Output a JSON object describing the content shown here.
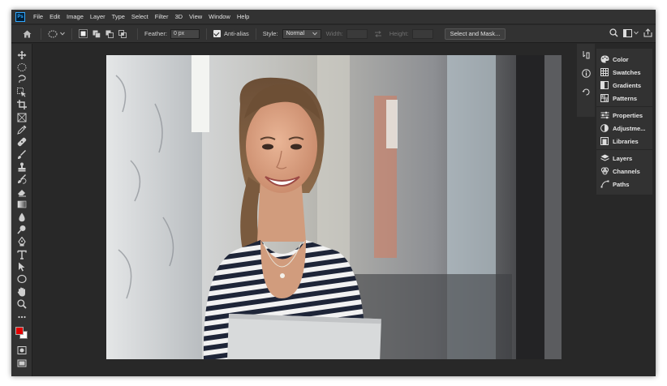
{
  "app": {
    "logo_text": "Ps"
  },
  "menu": [
    "File",
    "Edit",
    "Image",
    "Layer",
    "Type",
    "Select",
    "Filter",
    "3D",
    "View",
    "Window",
    "Help"
  ],
  "options": {
    "feather_label": "Feather:",
    "feather_value": "0 px",
    "antialias_label": "Anti-alias",
    "antialias_checked": true,
    "style_label": "Style:",
    "style_value": "Normal",
    "width_label": "Width:",
    "height_label": "Height:",
    "mask_button": "Select and Mask..."
  },
  "colors": {
    "foreground": "#e20000",
    "background": "#ffffff",
    "ui_dark": "#282828",
    "ui_panel": "#323232"
  },
  "tools": [
    "move-tool-icon",
    "marquee-tool-icon",
    "lasso-tool-icon",
    "object-select-tool-icon",
    "crop-tool-icon",
    "frame-tool-icon",
    "eyedropper-tool-icon",
    "healing-brush-tool-icon",
    "brush-tool-icon",
    "clone-stamp-tool-icon",
    "history-brush-tool-icon",
    "eraser-tool-icon",
    "gradient-tool-icon",
    "blur-tool-icon",
    "dodge-tool-icon",
    "pen-tool-icon",
    "type-tool-icon",
    "path-select-tool-icon",
    "shape-tool-icon",
    "hand-tool-icon",
    "zoom-tool-icon",
    "more-tools-icon"
  ],
  "panels": {
    "group1": [
      "Color",
      "Swatches",
      "Gradients",
      "Patterns"
    ],
    "group2": [
      "Properties",
      "Adjustme...",
      "Libraries"
    ],
    "group3": [
      "Layers",
      "Channels",
      "Paths"
    ]
  }
}
